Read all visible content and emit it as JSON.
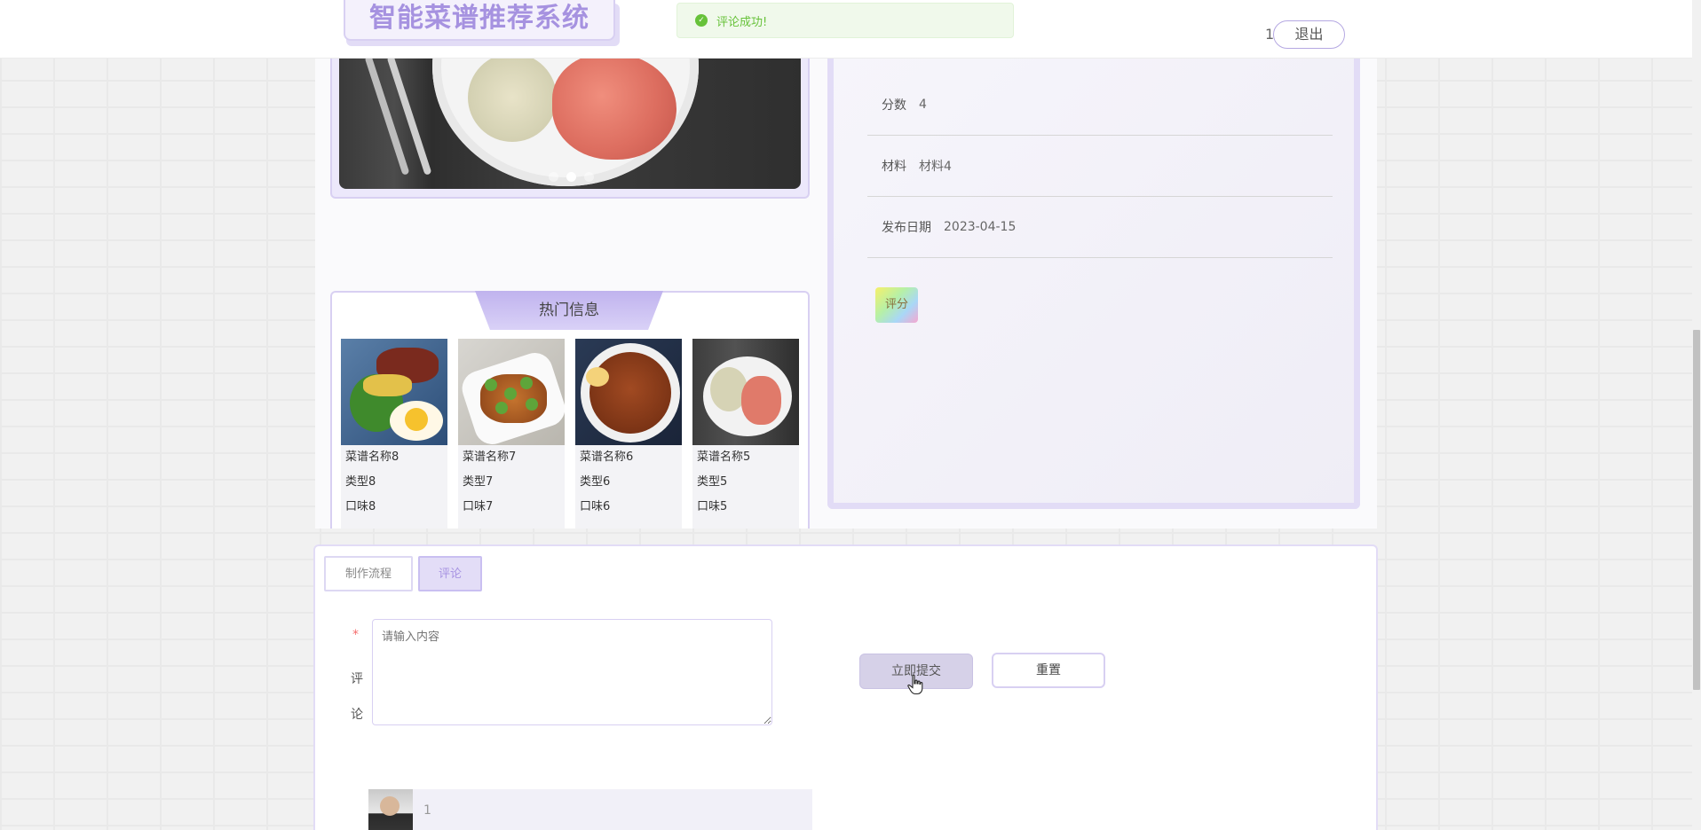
{
  "header": {
    "site_title": "智能菜谱推荐系统",
    "user_name": "1",
    "logout_label": "退出"
  },
  "toast": {
    "message": "评论成功!",
    "icon": "check-circle-icon",
    "color": "#67c23a"
  },
  "carousel": {
    "image": "grilled-shrimp-with-rice",
    "slide_count": 3,
    "active_index": 1
  },
  "detail": {
    "rows": [
      {
        "label": "分数",
        "value": "4"
      },
      {
        "label": "材料",
        "value": "材料4"
      },
      {
        "label": "发布日期",
        "value": "2023-04-15"
      }
    ],
    "rate_button": "评分"
  },
  "hot": {
    "title": "热门信息",
    "items": [
      {
        "name": "菜谱名称8",
        "type": "类型8",
        "taste": "口味8",
        "image": "rice-egg-broccoli-dish"
      },
      {
        "name": "菜谱名称7",
        "type": "类型7",
        "taste": "口味7",
        "image": "stir-fry-pepper-dish"
      },
      {
        "name": "菜谱名称6",
        "type": "类型6",
        "taste": "口味6",
        "image": "braised-chicken-dish"
      },
      {
        "name": "菜谱名称5",
        "type": "类型5",
        "taste": "口味5",
        "image": "shrimp-rice-plate"
      }
    ]
  },
  "tabs": [
    {
      "label": "制作流程",
      "active": false
    },
    {
      "label": "评论",
      "active": true
    }
  ],
  "comment_form": {
    "required_mark": "*",
    "label": "评论",
    "placeholder": "请输入内容",
    "submit_label": "立即提交",
    "reset_label": "重置"
  },
  "comments": [
    {
      "text": "1",
      "avatar": "user-avatar"
    }
  ],
  "colors": {
    "accent": "#a692e0",
    "accent_light": "#e2dcf6",
    "success": "#67c23a",
    "required": "#f56c6c"
  }
}
